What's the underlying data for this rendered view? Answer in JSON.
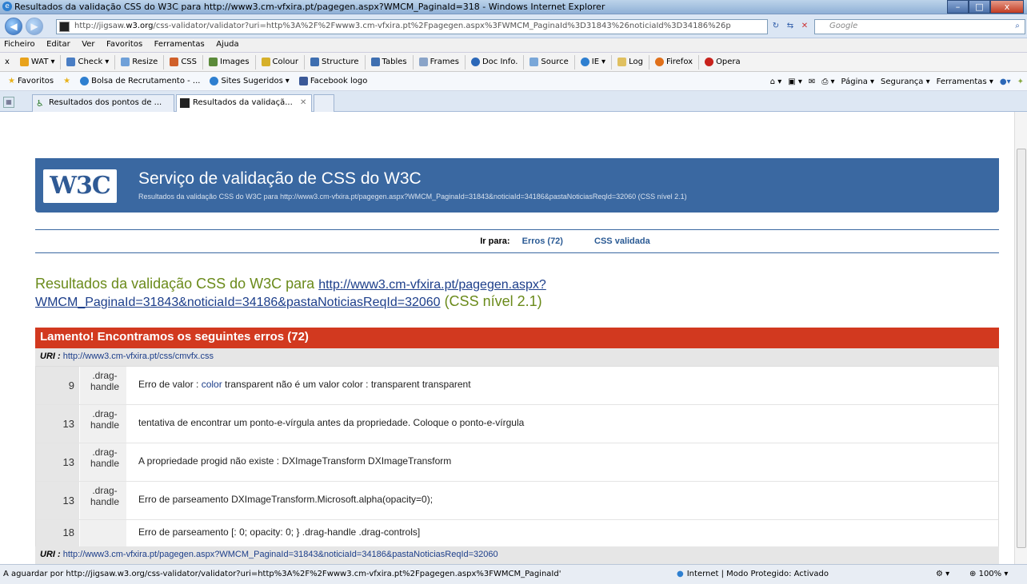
{
  "window": {
    "title": "Resultados da validação CSS do W3C para http://www3.cm-vfxira.pt/pagegen.aspx?WMCM_PaginaId=318 - Windows Internet Explorer",
    "min": "–",
    "max": "□",
    "close": "x"
  },
  "address": {
    "url_pre": "http://jigsaw.",
    "url_host": "w3.org",
    "url_post": "/css-validator/validator?uri=http%3A%2F%2Fwww3.cm-vfxira.pt%2Fpagegen.aspx%3FWMCM_PaginaId%3D31843%26noticiaId%3D34186%26p",
    "search_placeholder": "Google",
    "back": "◀",
    "fwd": "▶"
  },
  "menu": [
    "Ficheiro",
    "Editar",
    "Ver",
    "Favoritos",
    "Ferramentas",
    "Ajuda"
  ],
  "wat": [
    "WAT",
    "Check",
    "Resize",
    "CSS",
    "Images",
    "Colour",
    "Structure",
    "Tables",
    "Frames",
    "Doc Info.",
    "Source",
    "IE",
    "Log",
    "Firefox",
    "Opera"
  ],
  "fav": {
    "label": "Favoritos",
    "items": [
      "Bolsa de Recrutamento - ...",
      "Sites Sugeridos",
      "Facebook logo"
    ],
    "tools": [
      "Página",
      "Segurança",
      "Ferramentas"
    ]
  },
  "tabs": [
    "Resultados dos pontos de ...",
    "Resultados da validaçã..."
  ],
  "page": {
    "logo": "W3C",
    "banner_title": "Serviço de validação de CSS do W3C",
    "banner_sub": "Resultados da validação CSS do W3C para http://www3.cm-vfxira.pt/pagegen.aspx?WMCM_PaginaId=31843&noticiaId=34186&pastaNoticiasReqId=32060 (CSS nível 2.1)",
    "jump_label": "Ir para:",
    "jump_errors": "Erros (72)",
    "jump_valid": "CSS validada",
    "result_title_pre": "Resultados da validação CSS do W3C para ",
    "result_title_link": "http://www3.cm-vfxira.pt/pagegen.aspx?WMCM_PaginaId=31843&noticiaId=34186&pastaNoticiasReqId=32060",
    "result_title_post": " (CSS nível 2.1)",
    "errors_header": "Lamento! Encontramos os seguintes erros (72)",
    "uri_label": "URI :",
    "uri1": "http://www3.cm-vfxira.pt/css/cmvfx.css",
    "uri2": "http://www3.cm-vfxira.pt/pagegen.aspx?WMCM_PaginaId=31843&noticiaId=34186&pastaNoticiasReqId=32060",
    "rows": [
      {
        "line": "9",
        "ctx": ".drag-handle",
        "msg_pre": "Erro de valor : ",
        "msg_link": "color",
        "msg_post": " transparent não é um valor color : transparent transparent"
      },
      {
        "line": "13",
        "ctx": ".drag-handle",
        "msg_pre": "tentativa de encontrar um ponto-e-vírgula antes da propriedade. Coloque o ponto-e-vírgula",
        "msg_link": "",
        "msg_post": ""
      },
      {
        "line": "13",
        "ctx": ".drag-handle",
        "msg_pre": "A propriedade progid não existe : DXImageTransform DXImageTransform",
        "msg_link": "",
        "msg_post": ""
      },
      {
        "line": "13",
        "ctx": ".drag-handle",
        "msg_pre": "Erro de parseamento DXImageTransform.Microsoft.alpha(opacity=0);",
        "msg_link": "",
        "msg_post": ""
      },
      {
        "line": "18",
        "ctx": "",
        "msg_pre": "Erro de parseamento [: 0; opacity: 0; } .drag-handle .drag-controls]",
        "msg_link": "",
        "msg_post": ""
      }
    ]
  },
  "status": {
    "text": "A aguardar por http://jigsaw.w3.org/css-validator/validator?uri=http%3A%2F%2Fwww3.cm-vfxira.pt%2Fpagegen.aspx%3FWMCM_PaginaId'",
    "zone": "Internet | Modo Protegido: Activado",
    "zoom": "100%"
  }
}
